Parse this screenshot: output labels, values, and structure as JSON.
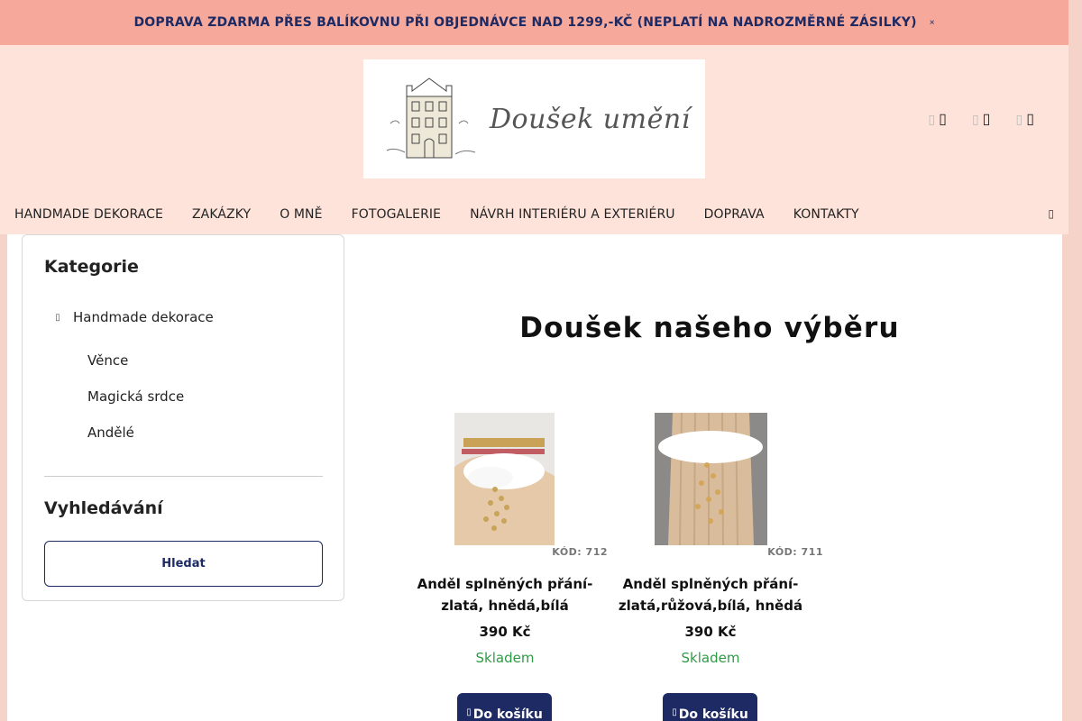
{
  "topbar": {
    "text": "DOPRAVA ZDARMA PŘES BALÍKOVNU PŘI OBJEDNÁVCE NAD 1299,-KČ (NEPLATÍ NA NADROZMĚRNÉ ZÁSILKY)",
    "close_glyph": "×"
  },
  "logo": {
    "text": "Doušek umění"
  },
  "header_icons": [
    {
      "name": "search-icon",
      "glyph": "⌕"
    },
    {
      "name": "user-icon",
      "glyph": "♙"
    },
    {
      "name": "cart-icon",
      "glyph": "🛒"
    }
  ],
  "nav": {
    "items": [
      "HANDMADE DEKORACE",
      "ZAKÁZKY",
      "O MNĚ",
      "FOTOGALERIE",
      "NÁVRH INTERIÉRU A EXTERIÉRU",
      "DOPRAVA",
      "KONTAKTY"
    ],
    "search_glyph": "⌕"
  },
  "sidebar": {
    "categories_title": "Kategorie",
    "root_category": "Handmade dekorace",
    "subcategories": [
      "Věnce",
      "Magická srdce",
      "Andělé"
    ],
    "search_title": "Vyhledávání",
    "search_button": "Hledat"
  },
  "main": {
    "title": "Doušek našeho výběru"
  },
  "products": [
    {
      "code": "KÓD: 712",
      "name": "Anděl splněných přání- zlatá, hnědá,bílá",
      "price": "390 Kč",
      "stock": "Skladem",
      "button": "Do košíku"
    },
    {
      "code": "KÓD: 711",
      "name": "Anděl splněných přání- zlatá,růžová,bílá, hnědá",
      "price": "390 Kč",
      "stock": "Skladem",
      "button": "Do košíku"
    }
  ],
  "colors": {
    "topbar_bg": "#f6a99a",
    "header_bg": "#fde3da",
    "brand_navy": "#1e2a63",
    "stock_green": "#2f9a45"
  }
}
